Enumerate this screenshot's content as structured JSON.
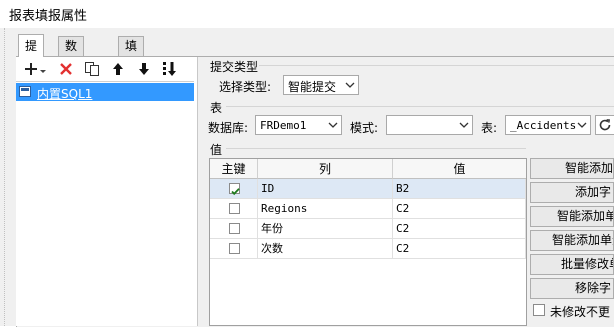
{
  "window": {
    "title": "报表填报属性"
  },
  "tabs": [
    {
      "label": "提交",
      "active": true
    },
    {
      "label": "数据校验",
      "active": false
    },
    {
      "label": "填报快捷键设置",
      "active": false
    }
  ],
  "toolbar": {
    "icons": [
      "add-dropdown-icon",
      "delete-icon",
      "copy-icon",
      "move-up-icon",
      "move-down-icon",
      "move-to-bottom-icon"
    ]
  },
  "tree": {
    "items": [
      {
        "label": "内置SQL1",
        "selected": true
      }
    ]
  },
  "submit_type": {
    "section_label": "提交类型",
    "select_label": "选择类型:",
    "select_value": "智能提交"
  },
  "table_section": {
    "section_label": "表",
    "database_label": "数据库:",
    "database_value": "FRDemo1",
    "schema_label": "模式:",
    "schema_value": "",
    "table_label": "表:",
    "table_value": "_Accidents"
  },
  "values_section": {
    "section_label": "值",
    "columns": [
      "主键",
      "列",
      "值"
    ],
    "rows": [
      {
        "key": true,
        "column": "ID",
        "value": "B2"
      },
      {
        "key": false,
        "column": "Regions",
        "value": "C2"
      },
      {
        "key": false,
        "column": "年份",
        "value": "C2"
      },
      {
        "key": false,
        "column": "次数",
        "value": "C2"
      }
    ]
  },
  "side_buttons": [
    {
      "label": "智能添加"
    },
    {
      "label": "添加字"
    },
    {
      "label": "智能添加单"
    },
    {
      "label": "智能添加单元"
    },
    {
      "label": "批量修改单"
    },
    {
      "label": "移除字"
    }
  ],
  "unmodified_checkbox": {
    "label": "未修改不更",
    "checked": false
  },
  "colors": {
    "selection": "#3399ff",
    "row_selected": "#dde8f5",
    "delete_red": "#e23030"
  }
}
